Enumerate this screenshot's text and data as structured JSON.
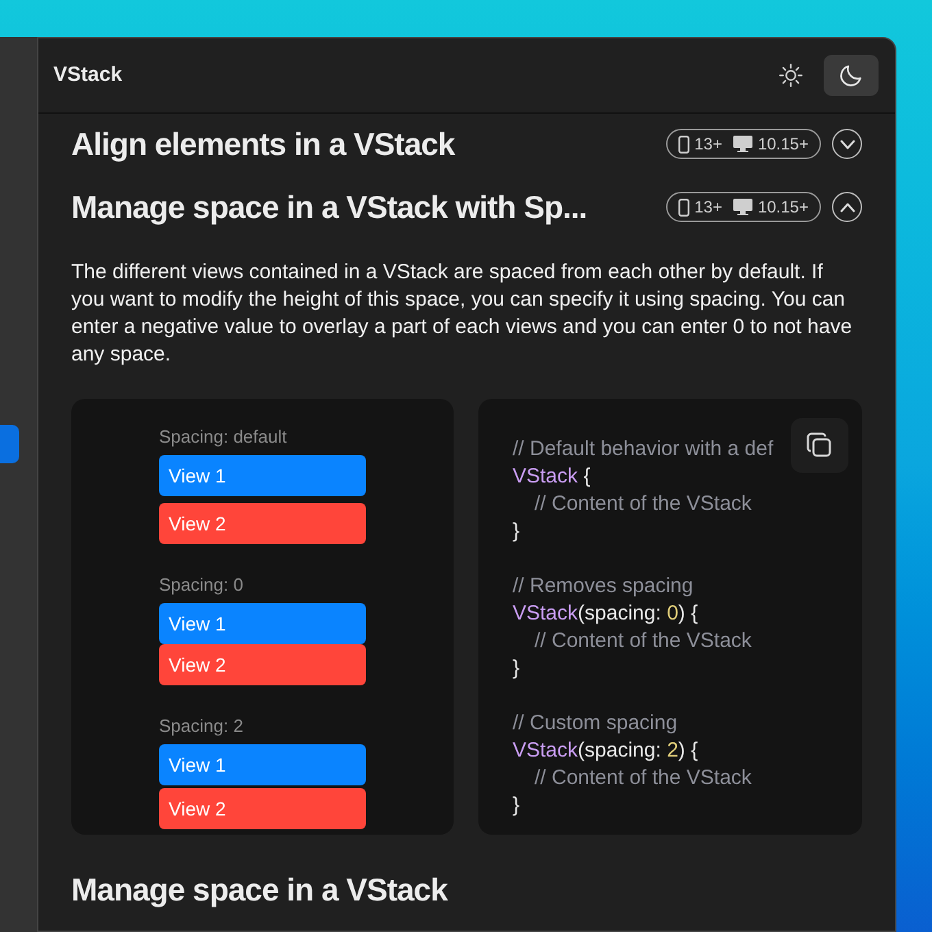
{
  "window": {
    "title": "VStack"
  },
  "appearance": [
    {
      "kind": "sun",
      "selected": false
    },
    {
      "kind": "moon",
      "selected": true
    }
  ],
  "sections": [
    {
      "title": "Align elements in a VStack",
      "badges": {
        "ios": "13+",
        "macos": "10.15+"
      },
      "expanded": false
    },
    {
      "title": "Manage space in a VStack with Sp...",
      "badges": {
        "ios": "13+",
        "macos": "10.15+"
      },
      "expanded": true,
      "description": "The different views contained in a VStack are spaced from each other by default. If you want to modify the height of this space, you can specify it using spacing. You can enter a negative value to overlay a part of each views and you can enter 0 to not have any space.",
      "preview": [
        {
          "label": "Spacing: default",
          "kind": "default",
          "views": [
            {
              "label": "View 1",
              "color": "#0a84ff"
            },
            {
              "label": "View 2",
              "color": "#ff453a"
            }
          ]
        },
        {
          "label": "Spacing: 0",
          "kind": "none",
          "views": [
            {
              "label": "View 1",
              "color": "#0a84ff"
            },
            {
              "label": "View 2",
              "color": "#ff453a"
            }
          ]
        },
        {
          "label": "Spacing: 2",
          "kind": "small",
          "views": [
            {
              "label": "View 1",
              "color": "#0a84ff"
            },
            {
              "label": "View 2",
              "color": "#ff453a"
            }
          ]
        }
      ],
      "code_blocks": [
        {
          "lines": [
            {
              "indented": false,
              "tokens": [
                {
                  "kind": "comment",
                  "text": "// Default behavior with a def"
                }
              ]
            },
            {
              "indented": false,
              "tokens": [
                {
                  "kind": "type",
                  "text": "VStack"
                },
                {
                  "kind": "plain",
                  "text": " {"
                }
              ]
            },
            {
              "indented": true,
              "tokens": [
                {
                  "kind": "comment",
                  "text": "// Content of the VStack"
                }
              ]
            },
            {
              "indented": false,
              "tokens": [
                {
                  "kind": "plain",
                  "text": "}"
                }
              ]
            }
          ]
        },
        {
          "lines": [
            {
              "indented": false,
              "tokens": [
                {
                  "kind": "comment",
                  "text": "// Removes spacing"
                }
              ]
            },
            {
              "indented": false,
              "tokens": [
                {
                  "kind": "type",
                  "text": "VStack"
                },
                {
                  "kind": "plain",
                  "text": "(spacing: "
                },
                {
                  "kind": "number",
                  "text": "0"
                },
                {
                  "kind": "plain",
                  "text": ") {"
                }
              ]
            },
            {
              "indented": true,
              "tokens": [
                {
                  "kind": "comment",
                  "text": "// Content of the VStack"
                }
              ]
            },
            {
              "indented": false,
              "tokens": [
                {
                  "kind": "plain",
                  "text": "}"
                }
              ]
            }
          ]
        },
        {
          "lines": [
            {
              "indented": false,
              "tokens": [
                {
                  "kind": "comment",
                  "text": "// Custom spacing"
                }
              ]
            },
            {
              "indented": false,
              "tokens": [
                {
                  "kind": "type",
                  "text": "VStack"
                },
                {
                  "kind": "plain",
                  "text": "(spacing: "
                },
                {
                  "kind": "number",
                  "text": "2"
                },
                {
                  "kind": "plain",
                  "text": ") {"
                }
              ]
            },
            {
              "indented": true,
              "tokens": [
                {
                  "kind": "comment",
                  "text": "// Content of the VStack"
                }
              ]
            },
            {
              "indented": false,
              "tokens": [
                {
                  "kind": "plain",
                  "text": "}"
                }
              ]
            }
          ]
        }
      ]
    },
    {
      "title": "Manage space in a VStack"
    }
  ]
}
